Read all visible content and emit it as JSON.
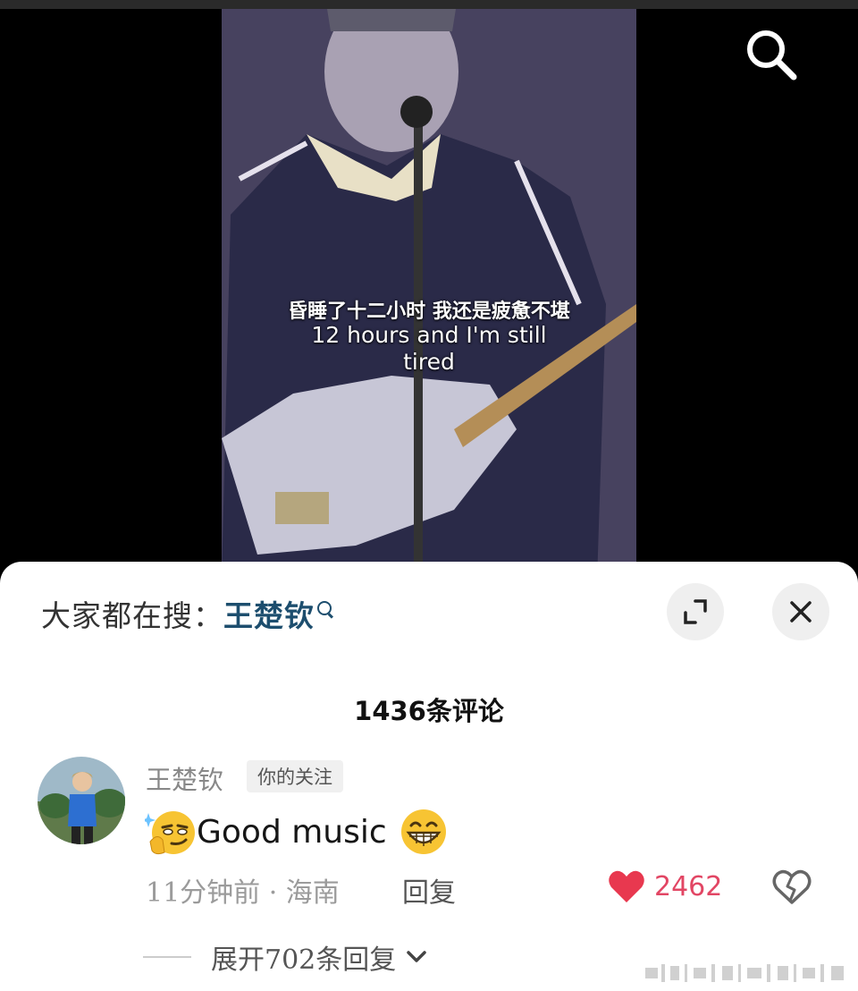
{
  "video": {
    "subtitle_cn": "昏睡了十二小时 我还是疲惫不堪",
    "subtitle_en": "12 hours and I'm still tired"
  },
  "icons": {
    "search": "search-icon",
    "expand": "expand-icon",
    "close": "close-icon",
    "like": "heart-icon",
    "dislike": "broken-heart-icon",
    "chevron": "chevron-down-icon"
  },
  "search_suggest": {
    "prefix": "大家都在搜：",
    "term": "王楚钦"
  },
  "comments_header": {
    "count_label": "1436条评论"
  },
  "comment": {
    "username": "王楚钦",
    "tag": "你的关注",
    "text": "Good music",
    "meta": "11分钟前 · 海南",
    "reply_label": "回复",
    "likes": "2462",
    "expand_replies": "展开702条回复"
  },
  "colors": {
    "like": "#e24664",
    "search_term": "#1d4e6e",
    "sheet_bg": "#ffffff"
  }
}
